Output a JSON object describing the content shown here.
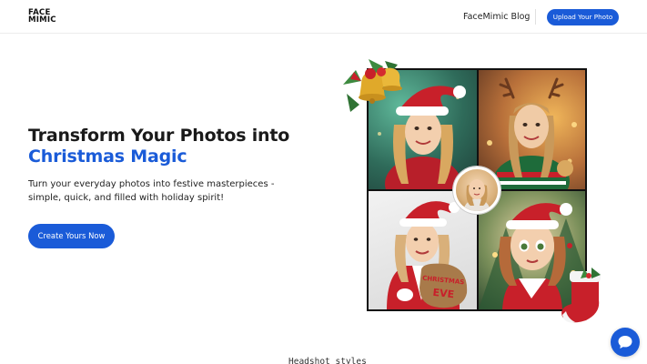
{
  "header": {
    "logo_line1": "FACE",
    "logo_line2": "MIMIC",
    "blog_link": "FaceMimic Blog",
    "upload_button": "Upload Your Photo"
  },
  "hero": {
    "title_line1": "Transform Your Photos into",
    "title_accent": "Christmas Magic",
    "subtitle": "Turn your everyday photos into festive masterpieces - simple, quick, and filled with holiday spirit!",
    "cta_button": "Create Yours Now"
  },
  "collage": {
    "tiles": [
      {
        "name": "santa-hat-portrait"
      },
      {
        "name": "reindeer-antlers-portrait"
      },
      {
        "name": "christmas-eve-sack-portrait"
      },
      {
        "name": "cartoon-3d-portrait"
      }
    ],
    "sack_text_line1": "CHRISTMAS",
    "sack_text_line2": "EVE"
  },
  "sections": {
    "next_heading": "Headshot styles"
  },
  "colors": {
    "brand_blue": "#1a5bd8",
    "santa_red": "#c8202a"
  },
  "icons": {
    "chat": "chat-bubble-icon",
    "bells": "christmas-bells-icon",
    "stocking": "christmas-stocking-icon"
  }
}
